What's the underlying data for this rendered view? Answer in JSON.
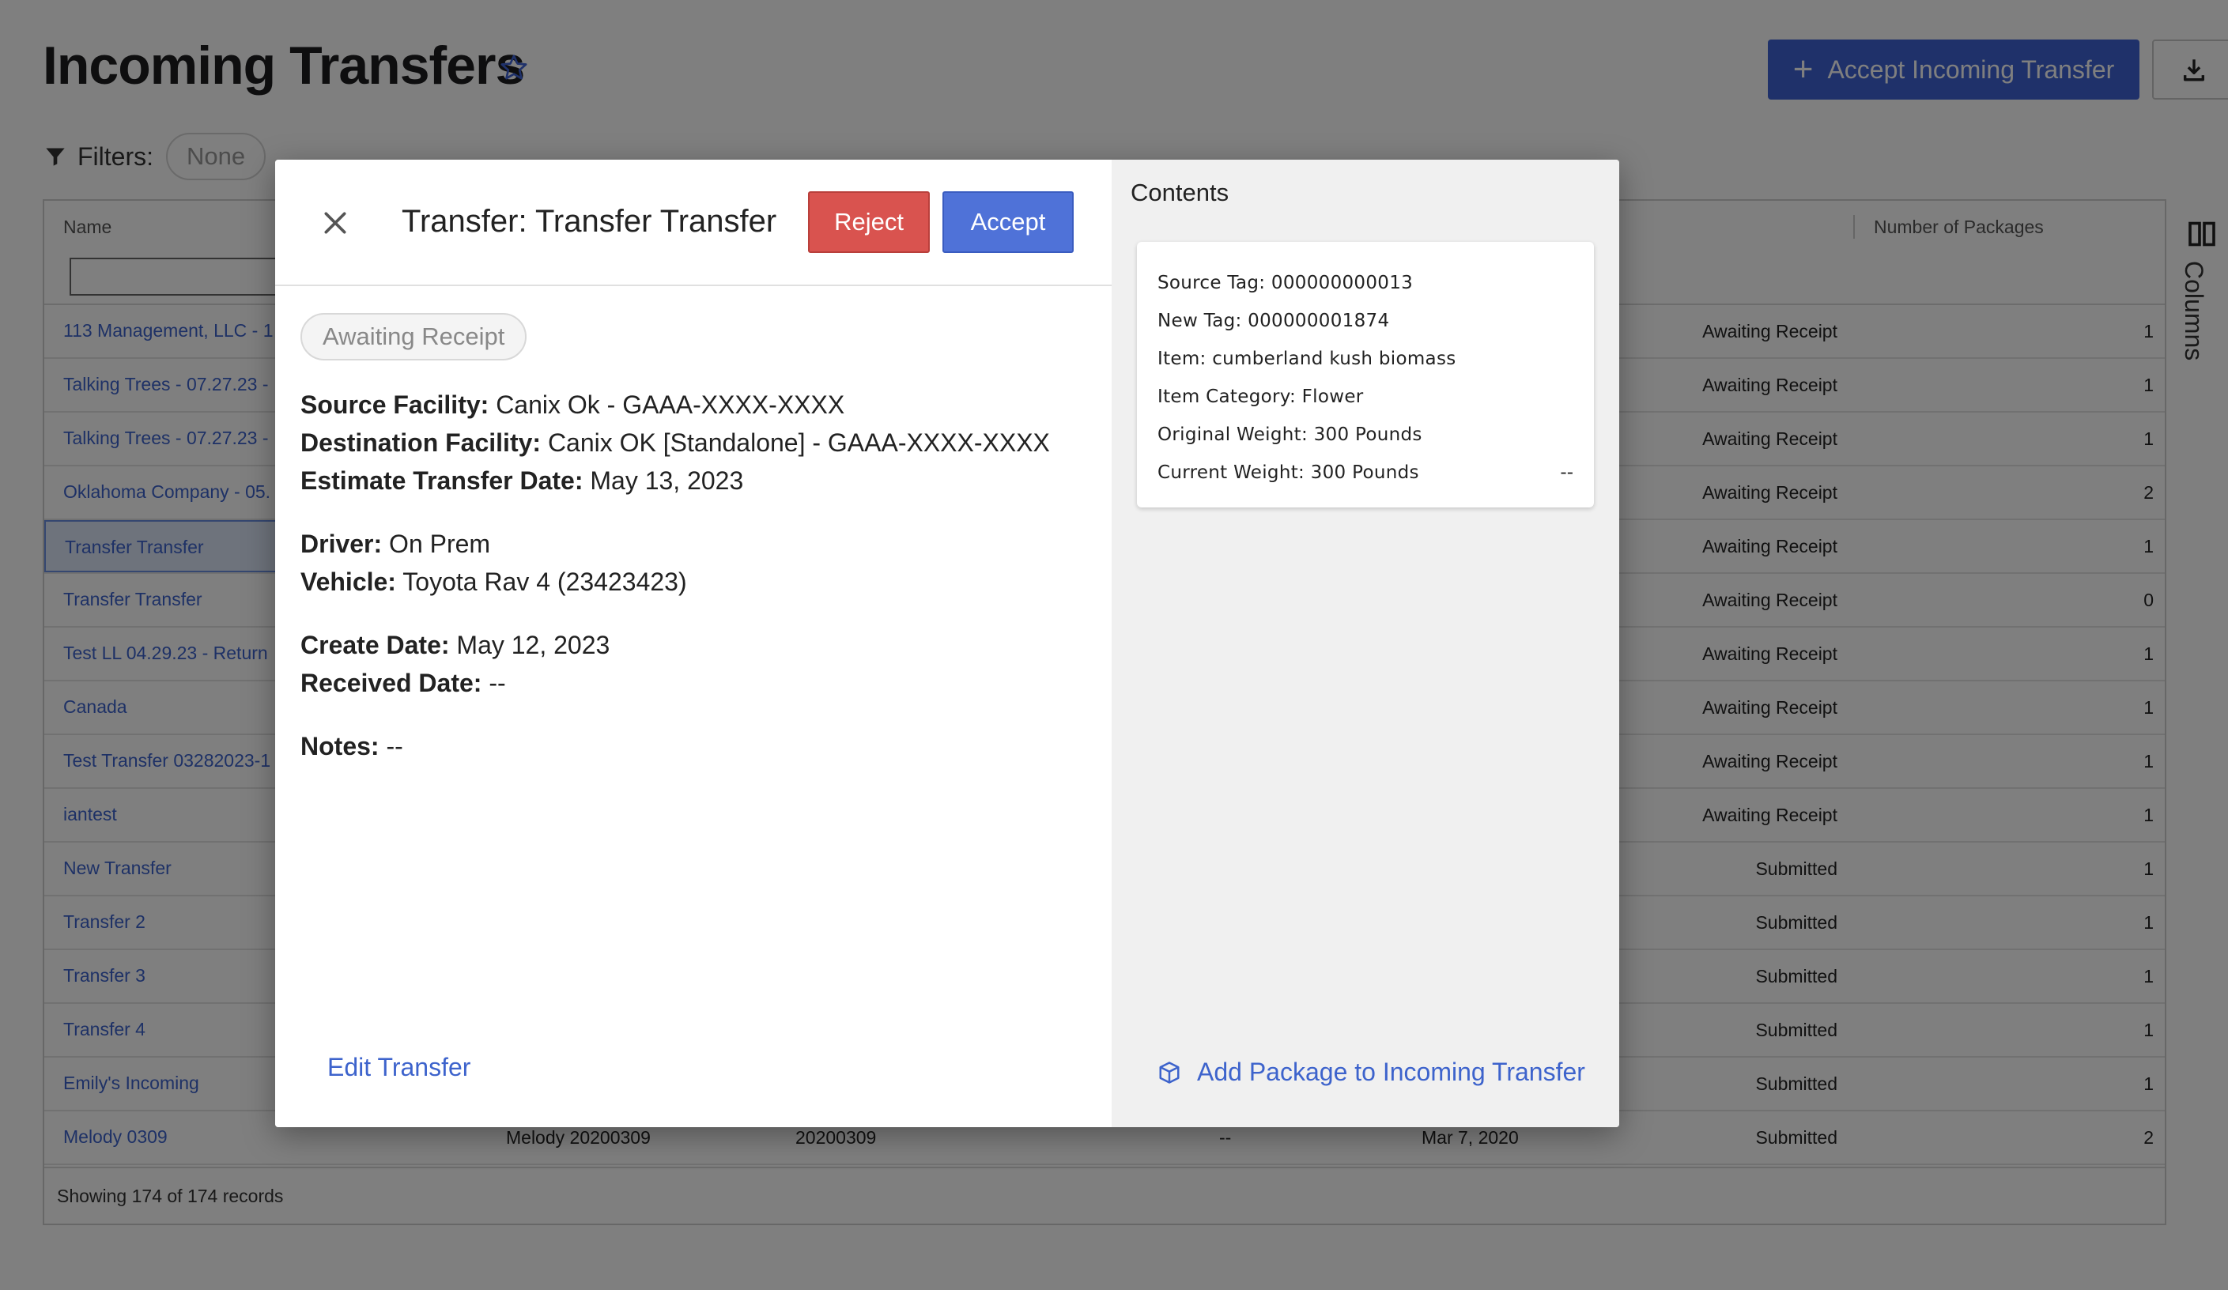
{
  "page": {
    "title": "Incoming Transfers",
    "accept_transfer_label": "Accept Incoming Transfer",
    "filters_label": "Filters:",
    "filters_value": "None"
  },
  "grid": {
    "columns": {
      "name": "Name",
      "packages": "Number of Packages"
    },
    "rows": [
      {
        "name": "113 Management, LLC - 1",
        "a": "",
        "b": "",
        "c": "",
        "d": "",
        "status": "Awaiting Receipt",
        "count": "1"
      },
      {
        "name": "Talking Trees - 07.27.23 -",
        "a": "",
        "b": "",
        "c": "",
        "d": "",
        "status": "Awaiting Receipt",
        "count": "1"
      },
      {
        "name": "Talking Trees - 07.27.23 -",
        "a": "",
        "b": "",
        "c": "",
        "d": "",
        "status": "Awaiting Receipt",
        "count": "1"
      },
      {
        "name": "Oklahoma Company - 05.",
        "a": "",
        "b": "",
        "c": "",
        "d": "",
        "status": "Awaiting Receipt",
        "count": "2"
      },
      {
        "name": "Transfer Transfer",
        "a": "",
        "b": "",
        "c": "",
        "d": "",
        "status": "Awaiting Receipt",
        "count": "1"
      },
      {
        "name": "Transfer Transfer",
        "a": "",
        "b": "",
        "c": "",
        "d": "",
        "status": "Awaiting Receipt",
        "count": "0"
      },
      {
        "name": "Test LL 04.29.23 - Return",
        "a": "",
        "b": "",
        "c": "",
        "d": "",
        "status": "Awaiting Receipt",
        "count": "1"
      },
      {
        "name": "Canada",
        "a": "",
        "b": "",
        "c": "",
        "d": "",
        "status": "Awaiting Receipt",
        "count": "1"
      },
      {
        "name": "Test Transfer 03282023-1",
        "a": "",
        "b": "",
        "c": "",
        "d": "",
        "status": "Awaiting Receipt",
        "count": "1"
      },
      {
        "name": "iantest",
        "a": "",
        "b": "",
        "c": "",
        "d": "",
        "status": "Awaiting Receipt",
        "count": "1"
      },
      {
        "name": "New Transfer",
        "a": "",
        "b": "",
        "c": "",
        "d": "",
        "status": "Submitted",
        "count": "1"
      },
      {
        "name": "Transfer 2",
        "a": "",
        "b": "",
        "c": "",
        "d": "",
        "status": "Submitted",
        "count": "1"
      },
      {
        "name": "Transfer 3",
        "a": "",
        "b": "",
        "c": "",
        "d": "",
        "status": "Submitted",
        "count": "1"
      },
      {
        "name": "Transfer 4",
        "a": "",
        "b": "",
        "c": "",
        "d": "",
        "status": "Submitted",
        "count": "1"
      },
      {
        "name": "Emily's Incoming",
        "a": "",
        "b": "",
        "c": "",
        "d": "",
        "status": "Submitted",
        "count": "1"
      },
      {
        "name": "Melody 0309",
        "a": "Melody 20200309",
        "b": "20200309",
        "c": "--",
        "d": "Mar 7, 2020",
        "status": "Submitted",
        "count": "2"
      }
    ],
    "footer": "Showing 174 of 174 records",
    "columns_panel_label": "Columns"
  },
  "modal": {
    "title": "Transfer: Transfer Transfer",
    "reject_label": "Reject",
    "accept_label": "Accept",
    "status": "Awaiting Receipt",
    "source_facility_label": "Source Facility:",
    "source_facility": "Canix Ok - GAAA-XXXX-XXXX",
    "destination_facility_label": "Destination Facility:",
    "destination_facility": "Canix OK [Standalone] - GAAA-XXXX-XXXX",
    "estimate_date_label": "Estimate Transfer Date:",
    "estimate_date": "May 13, 2023",
    "driver_label": "Driver:",
    "driver": "On Prem",
    "vehicle_label": "Vehicle:",
    "vehicle": "Toyota Rav 4 (23423423)",
    "create_date_label": "Create Date:",
    "create_date": "May 12, 2023",
    "received_date_label": "Received Date:",
    "received_date": "--",
    "notes_label": "Notes:",
    "notes": "--",
    "edit_label": "Edit Transfer"
  },
  "contents": {
    "title": "Contents",
    "package": {
      "source_tag": "Source Tag: 000000000013",
      "new_tag": "New Tag: 000000001874",
      "item": "Item: cumberland kush biomass",
      "category": "Item Category: Flower",
      "original_weight": "Original Weight: 300 Pounds",
      "current_weight": "Current Weight: 300 Pounds",
      "trailing": "--"
    },
    "add_package_label": "Add Package to Incoming Transfer"
  },
  "colors": {
    "primary": "#3e63d5",
    "link": "#3d63cc",
    "danger": "#d9534f",
    "overlay": "rgba(0,0,0,0.5)"
  }
}
